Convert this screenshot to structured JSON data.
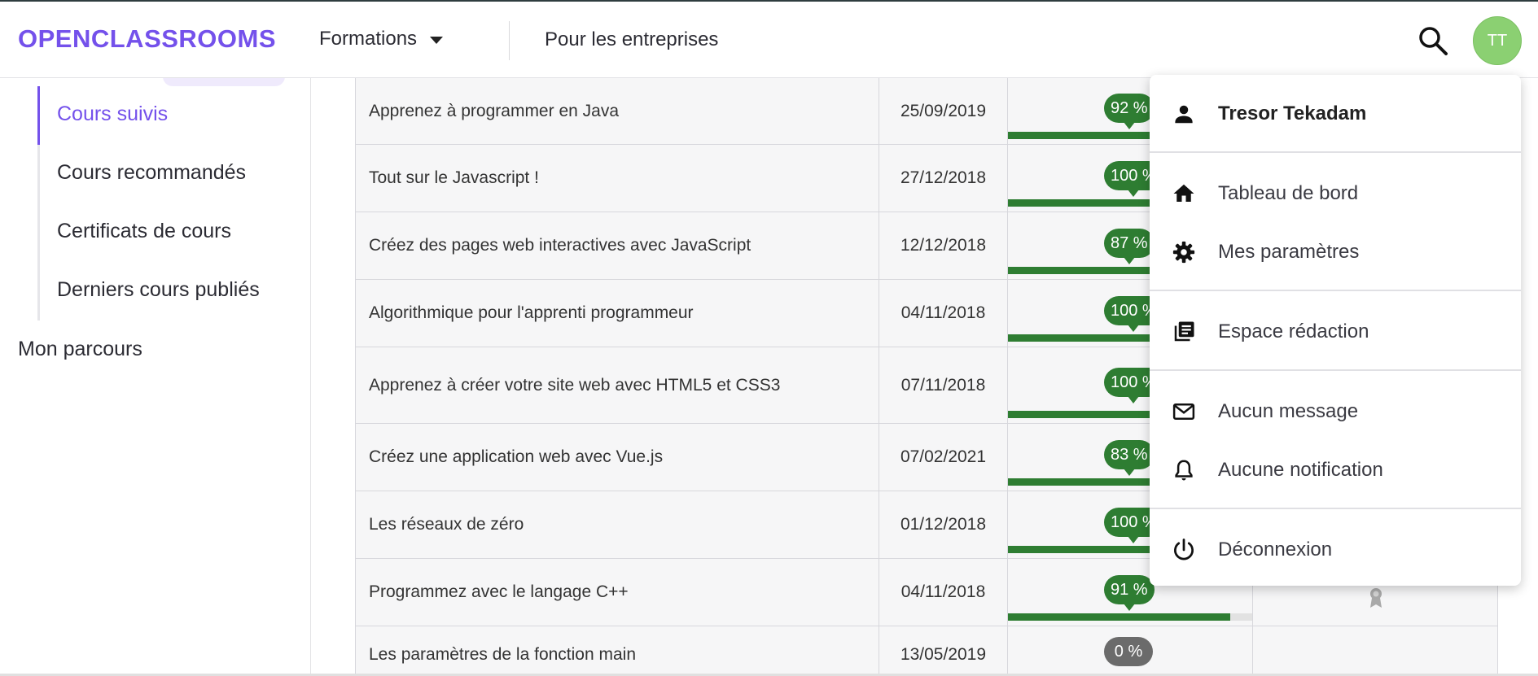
{
  "header": {
    "logo": "OPENCLASSROOMS",
    "formations_label": "Formations",
    "entreprises_label": "Pour les entreprises",
    "avatar_initials": "TT"
  },
  "sidebar": {
    "items": [
      {
        "label": "Cours suivis",
        "active": true
      },
      {
        "label": "Cours recommandés",
        "active": false
      },
      {
        "label": "Certificats de cours",
        "active": false
      },
      {
        "label": "Derniers cours publiés",
        "active": false
      }
    ],
    "section_label": "Mon parcours"
  },
  "courses": [
    {
      "title": "Apprenez à programmer en Java",
      "date": "25/09/2019",
      "progress": "92 %",
      "progress_value": 92
    },
    {
      "title": "Tout sur le Javascript !",
      "date": "27/12/2018",
      "progress": "100 %",
      "progress_value": 100
    },
    {
      "title": "Créez des pages web interactives avec JavaScript",
      "date": "12/12/2018",
      "progress": "87 %",
      "progress_value": 87
    },
    {
      "title": "Algorithmique pour l'apprenti programmeur",
      "date": "04/11/2018",
      "progress": "100 %",
      "progress_value": 100
    },
    {
      "title": "Apprenez à créer votre site web avec HTML5 et CSS3",
      "date": "07/11/2018",
      "progress": "100 %",
      "progress_value": 100
    },
    {
      "title": "Créez une application web avec Vue.js",
      "date": "07/02/2021",
      "progress": "83 %",
      "progress_value": 83
    },
    {
      "title": "Les réseaux de zéro",
      "date": "01/12/2018",
      "progress": "100 %",
      "progress_value": 100
    },
    {
      "title": "Programmez avec le langage C++",
      "date": "04/11/2018",
      "progress": "91 %",
      "progress_value": 91
    },
    {
      "title": "Les paramètres de la fonction main",
      "date": "13/05/2019",
      "progress": "0 %",
      "progress_value": 0
    }
  ],
  "user_menu": {
    "user_name": "Tresor Tekadam",
    "dashboard": "Tableau de bord",
    "settings": "Mes paramètres",
    "writing_space": "Espace rédaction",
    "messages": "Aucun message",
    "notifications": "Aucune notification",
    "logout": "Déconnexion"
  },
  "colors": {
    "brand": "#7451eb",
    "progress": "#2e7d32",
    "avatar": "#8bd072"
  }
}
